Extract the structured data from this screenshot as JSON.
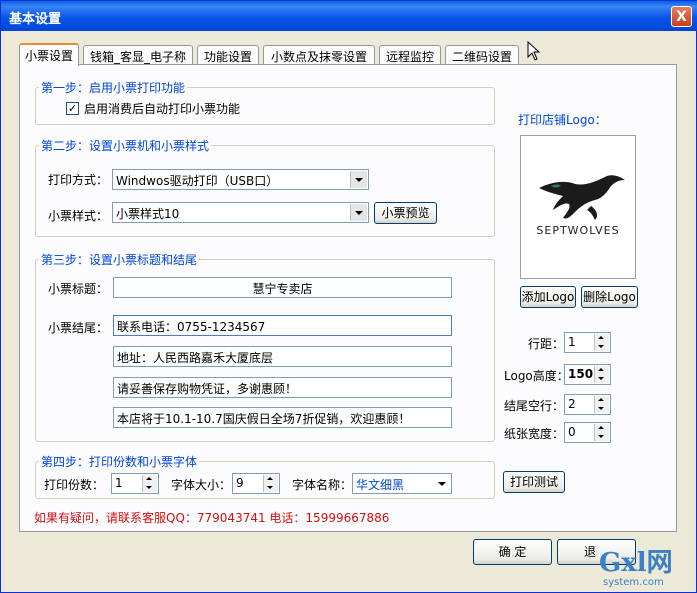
{
  "window": {
    "title": "基本设置",
    "close_glyph": "X"
  },
  "tabs": [
    {
      "label": "小票设置"
    },
    {
      "label": "钱箱_客显_电子称"
    },
    {
      "label": "功能设置"
    },
    {
      "label": "小数点及抹零设置"
    },
    {
      "label": "远程监控"
    },
    {
      "label": "二维码设置"
    }
  ],
  "step1": {
    "title": "第一步：启用小票打印功能",
    "checkbox_label": "启用消费后自动打印小票功能",
    "checked": true
  },
  "step2": {
    "title": "第二步：设置小票机和小票样式",
    "print_mode_label": "打印方式：",
    "print_mode_value": "Windwos驱动打印（USB口）",
    "style_label": "小票样式：",
    "style_value": "小票样式10",
    "preview_button": "小票预览"
  },
  "step3": {
    "title": "第三步：设置小票标题和结尾",
    "title_label": "小票标题：",
    "title_value": "慧宁专卖店",
    "footer_label": "小票结尾：",
    "footer_lines": [
      "联系电话：0755-1234567",
      "地址：人民西路嘉禾大厦底层",
      "请妥善保存购物凭证，多谢惠顾！",
      "本店将于10.1-10.7国庆假日全场7折促销，欢迎惠顾！"
    ]
  },
  "step4": {
    "title": "第四步：打印份数和小票字体",
    "copies_label": "打印份数：",
    "copies_value": "1",
    "font_size_label": "字体大小：",
    "font_size_value": "9",
    "font_name_label": "字体名称：",
    "font_name_value": "华文细黑"
  },
  "logo_panel": {
    "title": "打印店铺Logo：",
    "logo_text": "SEPTWOLVES",
    "add_button": "添加Logo",
    "delete_button": "删除Logo",
    "line_spacing_label": "行距：",
    "line_spacing_value": "1",
    "logo_height_label": "Logo高度：",
    "logo_height_value": "150",
    "end_blank_label": "结尾空行：",
    "end_blank_value": "2",
    "paper_width_label": "纸张宽度：",
    "paper_width_value": "0",
    "test_print_button": "打印测试"
  },
  "contact_note": "如果有疑问，请联系客服QQ：779043741 电话：15999667886",
  "ok_button": "确 定",
  "exit_button": "退",
  "watermark": {
    "text": "Gxl网",
    "sub": "system.com"
  },
  "colors": {
    "title_bar": "#0856E6",
    "legend_text": "#0046D5",
    "note_text": "#D01010",
    "tab_highlight": "#E68B2C"
  }
}
